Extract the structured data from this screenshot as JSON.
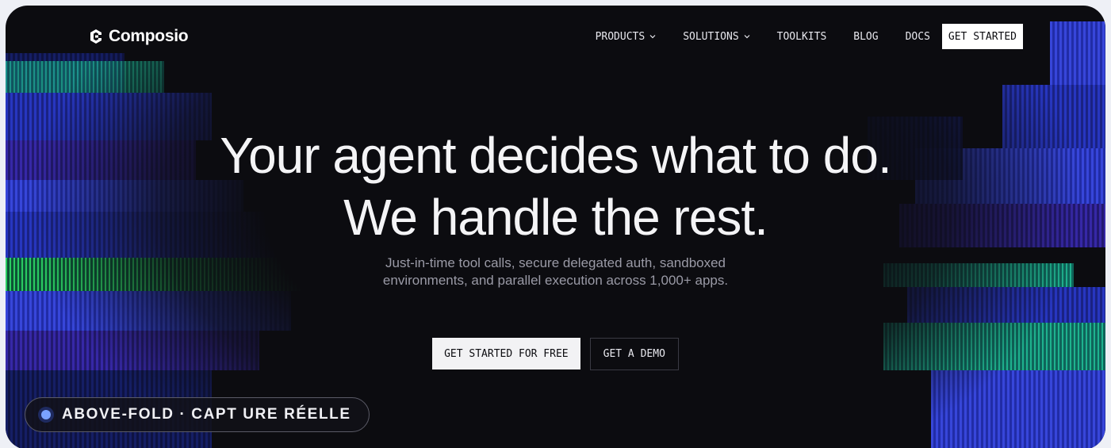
{
  "brand": {
    "name": "Composio",
    "logo_icon": "composio-logo-icon"
  },
  "nav": {
    "items": [
      {
        "label": "PRODUCTS",
        "has_dropdown": true
      },
      {
        "label": "SOLUTIONS",
        "has_dropdown": true
      },
      {
        "label": "TOOLKITS",
        "has_dropdown": false
      },
      {
        "label": "BLOG",
        "has_dropdown": false
      },
      {
        "label": "DOCS",
        "has_dropdown": false
      }
    ],
    "cta_label": "GET STARTED"
  },
  "hero": {
    "title_line1": "Your agent decides what to do.",
    "title_line2": "We handle the rest.",
    "subtitle_line1": "Just-in-time tool calls, secure delegated auth, sandboxed",
    "subtitle_line2": "environments, and parallel execution across 1,000+ apps.",
    "primary_cta": "GET STARTED FOR FREE",
    "secondary_cta": "GET A DEMO"
  },
  "badge": {
    "label": "ABOVE-FOLD · CAPT URE RÉELLE",
    "dot_icon": "status-dot-icon"
  },
  "colors": {
    "background": "#0c0c10",
    "accent_blue": "#2a3bd4",
    "accent_teal": "#20c49c",
    "accent_green": "#2de06a",
    "text": "#f4f4f6",
    "muted": "#9a9aa6"
  }
}
